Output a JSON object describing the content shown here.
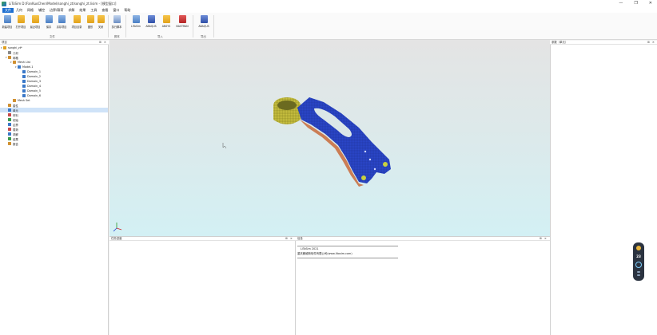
{
  "titlebar": {
    "title": "LiToSim D:/FanKuoChen/Model/songhi_zt/songhi_zt.lisim - [模型窗口]",
    "minimize": "—",
    "maximize": "❐",
    "close": "✕"
  },
  "menu": [
    "文件",
    "几何",
    "网格",
    "辅控",
    "边界/载荷",
    "求解",
    "结果",
    "工具",
    "查看",
    "窗口",
    "帮助"
  ],
  "ribbon": {
    "buttons": [
      {
        "label": "新建项目",
        "icon": "new-project-icon"
      },
      {
        "label": "打开项目",
        "icon": "open-project-icon"
      },
      {
        "label": "最近项目",
        "icon": "recent-project-icon"
      },
      {
        "label": "保存",
        "icon": "save-icon"
      },
      {
        "label": "另存项目",
        "icon": "save-as-icon"
      },
      {
        "label": "项目目录",
        "icon": "project-folder-icon"
      },
      {
        "label": "图形",
        "icon": "graphics-icon"
      },
      {
        "label": "关闭",
        "icon": "close-project-icon"
      },
      {
        "label": "执行脚本",
        "icon": "run-script-icon"
      },
      {
        "label": "LiToSim",
        "icon": "litosim-import-icon"
      },
      {
        "label": "ABAQUS",
        "icon": "abaqus-import-icon"
      },
      {
        "label": "ANSYS",
        "icon": "ansys-import-icon"
      },
      {
        "label": "NASTRAN",
        "icon": "nastran-import-icon"
      },
      {
        "label": "ABAQUS",
        "icon": "abaqus-export-icon"
      }
    ],
    "groups": [
      "文件",
      "脚本",
      "导入",
      "导出"
    ]
  },
  "tree_panel": {
    "title": "项目",
    "items": [
      {
        "label": "songhi_zt*",
        "level": 0,
        "toggle": "▾",
        "color": "#e0a020"
      },
      {
        "label": "几何",
        "level": 1,
        "toggle": "",
        "color": "#8a8a8a"
      },
      {
        "label": "网格",
        "level": 1,
        "toggle": "▾",
        "color": "#d09030"
      },
      {
        "label": "Mesh List",
        "level": 2,
        "toggle": "▾",
        "color": "#d09030"
      },
      {
        "label": "Model-1",
        "level": 3,
        "toggle": "▾",
        "color": "#3a78c8"
      },
      {
        "label": "Domain_1",
        "level": 4,
        "toggle": "",
        "color": "#3a78c8"
      },
      {
        "label": "Domain_2",
        "level": 4,
        "toggle": "",
        "color": "#3a78c8"
      },
      {
        "label": "Domain_3",
        "level": 4,
        "toggle": "",
        "color": "#3a78c8"
      },
      {
        "label": "Domain_4",
        "level": 4,
        "toggle": "",
        "color": "#3a78c8"
      },
      {
        "label": "Domain_5",
        "level": 4,
        "toggle": "",
        "color": "#3a78c8"
      },
      {
        "label": "Domain_6",
        "level": 4,
        "toggle": "",
        "color": "#3a78c8"
      },
      {
        "label": "Mesh Set",
        "level": 2,
        "toggle": "",
        "color": "#d09030"
      },
      {
        "label": "属性",
        "level": 1,
        "toggle": "",
        "color": "#d09030"
      },
      {
        "label": "单元",
        "level": 1,
        "toggle": "",
        "color": "#3a78c8",
        "selected": true
      },
      {
        "label": "材料",
        "level": 1,
        "toggle": "",
        "color": "#c84a4a"
      },
      {
        "label": "初始",
        "level": 1,
        "toggle": "",
        "color": "#3a9a4a"
      },
      {
        "label": "边界",
        "level": 1,
        "toggle": "",
        "color": "#3a78c8"
      },
      {
        "label": "载荷",
        "level": 1,
        "toggle": "",
        "color": "#c84a4a"
      },
      {
        "label": "求解",
        "level": 1,
        "toggle": "",
        "color": "#3a78c8"
      },
      {
        "label": "结果",
        "level": 1,
        "toggle": "",
        "color": "#3a9a4a"
      },
      {
        "label": "报告",
        "level": 1,
        "toggle": "",
        "color": "#d09030"
      }
    ]
  },
  "bottom_left": {
    "title": "任务进度"
  },
  "output": {
    "title": "信息",
    "lines": [
      "LiToSim 2021",
      "重庆朗维斯软件有限公司(www.litosim.com)"
    ]
  },
  "right_panel": {
    "title": "参数（单元）"
  },
  "panel_pin": "✕",
  "widget": {
    "value": "23"
  }
}
